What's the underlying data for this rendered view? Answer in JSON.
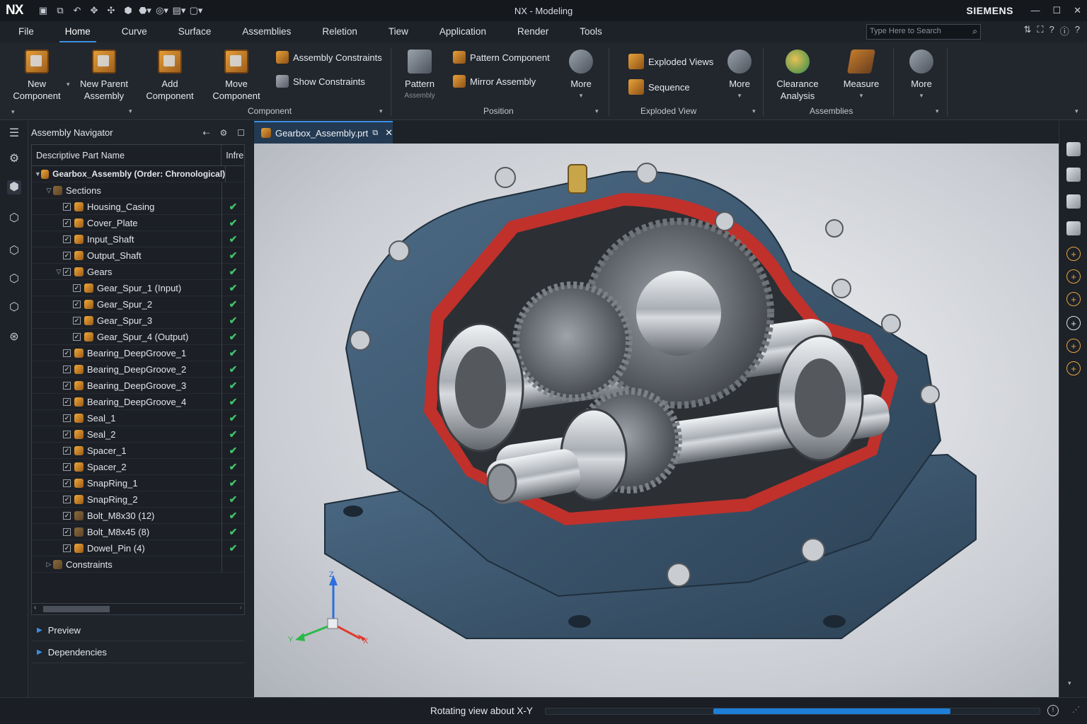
{
  "titlebar": {
    "app_logo": "NX",
    "window_title": "NX - Modeling",
    "brand": "SIEMENS",
    "qat_icons": [
      "save-icon",
      "save-as-icon",
      "undo-icon",
      "move-icon",
      "snap-icon",
      "part-icon",
      "component-icon",
      "render-icon",
      "shape-icon",
      "select-icon"
    ]
  },
  "menu": {
    "tabs": [
      "File",
      "Home",
      "Curve",
      "Surface",
      "Assemblies",
      "Reletion",
      "Tiew",
      "Application",
      "Render",
      "Tools"
    ],
    "active": "Home",
    "search_placeholder": "Type Here to Search"
  },
  "ribbon": {
    "new_component": "New\nComponent",
    "new_parent_assembly": "New Parent\nAssembly",
    "add_component": "Add\nComponent",
    "move_component": "Move\nComponent",
    "assembly_constraints": "Assembly Constraints",
    "show_constraints": "Show Constraints",
    "group_component": "Component",
    "pattern_assembly": "Pattern",
    "pattern_sub": "Assembly",
    "pattern_component": "Pattern Component",
    "mirror_assembly": "Mirror Assembly",
    "more_position": "More",
    "group_position": "Position",
    "exploded_views": "Exploded Views",
    "sequence": "Sequence",
    "more_exploded": "More",
    "group_exploded": "Exploded View",
    "clearance_analysis": "Clearance\nAnalysis",
    "measure": "Measure",
    "more_assemblies": "More",
    "group_assemblies": "Assemblies"
  },
  "navigator": {
    "title": "Assembly Navigator",
    "col_name": "Descriptive Part Name",
    "col_info": "Infre",
    "rows": [
      {
        "label": "Gearbox_Assembly (Order: Chronological)",
        "bold": true
      },
      {
        "label": "Sections"
      },
      {
        "label": "Housing_Casing",
        "status": "✔"
      },
      {
        "label": "Cover_Plate",
        "status": "✔"
      },
      {
        "label": "Input_Shaft",
        "status": "✔"
      },
      {
        "label": "Output_Shaft",
        "status": "✔"
      },
      {
        "label": "Gears",
        "status": "✔"
      },
      {
        "label": "Gear_Spur_1 (Input)",
        "status": "✔"
      },
      {
        "label": "Gear_Spur_2",
        "status": "✔"
      },
      {
        "label": "Gear_Spur_3",
        "status": "✔"
      },
      {
        "label": "Gear_Spur_4 (Output)",
        "status": "✔"
      },
      {
        "label": "Bearing_DeepGroove_1",
        "status": "✔"
      },
      {
        "label": "Bearing_DeepGroove_2",
        "status": "✔"
      },
      {
        "label": "Bearing_DeepGroove_3",
        "status": "✔"
      },
      {
        "label": "Bearing_DeepGroove_4",
        "status": "✔"
      },
      {
        "label": "Seal_1",
        "status": "✔"
      },
      {
        "label": "Seal_2",
        "status": "✔"
      },
      {
        "label": "Spacer_1",
        "status": "✔"
      },
      {
        "label": "Spacer_2",
        "status": "✔"
      },
      {
        "label": "SnapRing_1",
        "status": "✔"
      },
      {
        "label": "SnapRing_2",
        "status": "✔"
      },
      {
        "label": "Bolt_M8x30 (12)",
        "status": "✔"
      },
      {
        "label": "Bolt_M8x45 (8)",
        "status": "✔"
      },
      {
        "label": "Dowel_Pin (4)",
        "status": "✔"
      },
      {
        "label": "Constraints"
      }
    ],
    "preview": "Preview",
    "dependencies": "Dependencies"
  },
  "document": {
    "tab_label": "Gearbox_Assembly.prt"
  },
  "viewport": {
    "triad": {
      "x": "X",
      "y": "Y",
      "z": "Z"
    },
    "colors": {
      "housing": "#3d5a73",
      "cut_face": "#c0312c",
      "steel": "#b9bec4"
    }
  },
  "status": {
    "message": "Rotating view about X-Y",
    "progress_start": 0.34,
    "progress_end": 0.82
  }
}
